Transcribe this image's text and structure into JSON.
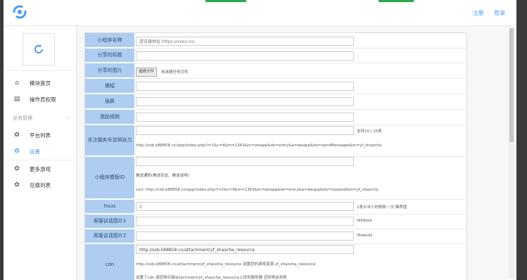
{
  "header": {
    "links": [
      "注册",
      "登录"
    ]
  },
  "sidebar": {
    "items": [
      {
        "label": "模块首页",
        "icon": "home-icon"
      },
      {
        "label": "操作员权限",
        "icon": "document-icon"
      },
      {
        "label": "平台列表",
        "icon": "gear-icon"
      },
      {
        "label": "设置",
        "icon": "gear-icon"
      },
      {
        "label": "更多游戏",
        "icon": "gear-icon"
      },
      {
        "label": "兑换列表",
        "icon": "gear-icon"
      }
    ],
    "section": "业务管理"
  },
  "form": {
    "rows": [
      {
        "label": "小程序名称",
        "value": "游览器地址 https://xxxx.cn/"
      },
      {
        "label": "分享的标题",
        "value": ""
      },
      {
        "label": "分享的图片",
        "button": "选择文件",
        "status": "未选择任何文件"
      },
      {
        "label": "横幅",
        "value": ""
      },
      {
        "label": "插屏",
        "value": ""
      },
      {
        "label": "激励视频",
        "value": ""
      },
      {
        "label": "关注服务号说明张力",
        "value": "",
        "note_right": "支持10 / 25条",
        "note": "http://sxb.k88858.cn/app/index.php?i=1&c=4&m=1363&m=weapp&do=entry&a=weapp&do=sendMessages&m=yf_shaocha"
      },
      {
        "label": "小程序模板ID",
        "value": "",
        "note1": "推送通知(推送状态、推送说明)",
        "note2": "curl: http://sxb.k88858.cn/app/index.php?i=2&c=4&m=1363&m=weapp&do=entry&a=weapp&do=mysend&m=yf_shaocha"
      },
      {
        "label": "hous",
        "value": "0",
        "note_right": "1表示半小时刷新一次 推荐值"
      },
      {
        "label": "客服谈话图片1",
        "value": "",
        "note_right": "f9fd0a4"
      },
      {
        "label": "客服谈话图片2",
        "value": "",
        "note_right": "f9deed2"
      },
      {
        "label": "cdn",
        "value": "http://sxb.k88858.cn/attachment/yf_shaocha_resource",
        "note1": "http://sxb.k88858.cn/attachment/yf_shaocha_resource 设置您的游戏资源 yf_shaocha_resource",
        "note2": "设置了cdn 请您将目录attachment/yf_shaocha_resource上传到服务器 否则将会失败"
      }
    ]
  },
  "colors": {
    "accent": "#4a9cf2",
    "label_bg": "#aecdf0",
    "green": "#2aa84a"
  }
}
